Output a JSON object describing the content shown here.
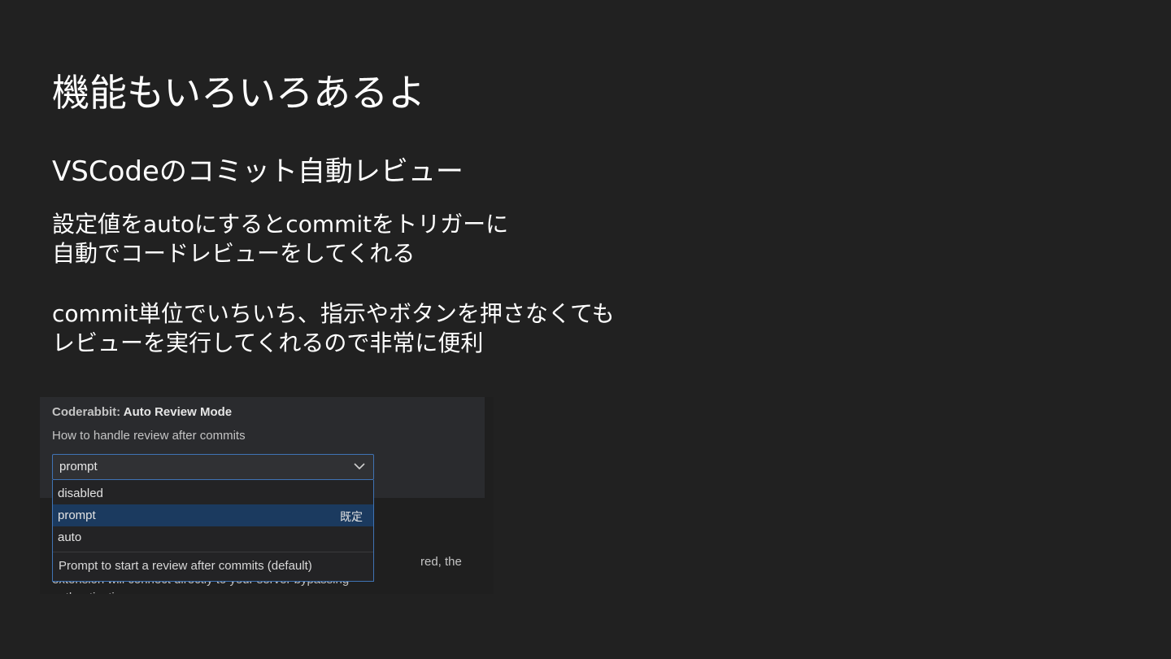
{
  "slide": {
    "title": "機能もいろいろあるよ",
    "subtitle": "VSCodeのコミット自動レビュー",
    "body_lines": [
      "設定値をautoにするとcommitをトリガーに",
      "自動でコードレビューをしてくれる",
      "commit単位でいちいち、指示やボタンを押さなくても",
      "レビューを実行してくれるので非常に便利"
    ]
  },
  "settings": {
    "title_prefix": "Coderabbit: ",
    "title": "Auto Review Mode",
    "description": "How to handle review after commits",
    "selected_value": "prompt",
    "options": [
      {
        "label": "disabled",
        "tag": ""
      },
      {
        "label": "prompt",
        "tag": "既定"
      },
      {
        "label": "auto",
        "tag": ""
      }
    ],
    "option_description": "Prompt to start a review after commits (default)",
    "behind_text": [
      "red, the",
      "extension will connect directly to your server bypassing",
      "authentication"
    ],
    "colors": {
      "accent_border": "#3f73b4",
      "highlight_row": "#1b3a5f",
      "background": "#212121"
    }
  }
}
